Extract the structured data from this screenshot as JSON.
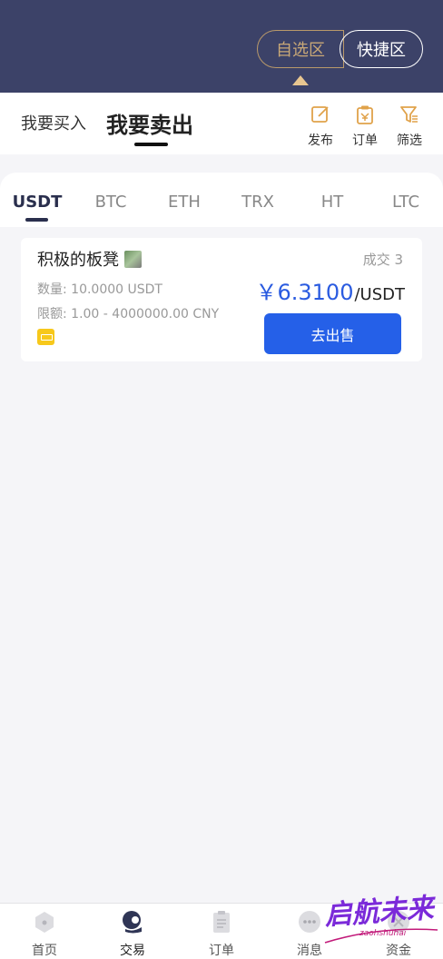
{
  "header": {
    "segment_left": "自选区",
    "segment_right": "快捷区"
  },
  "mode": {
    "buy_label": "我要买入",
    "sell_label": "我要卖出",
    "tools": [
      {
        "label": "发布",
        "icon": "edit-icon"
      },
      {
        "label": "订单",
        "icon": "clipboard-icon"
      },
      {
        "label": "筛选",
        "icon": "filter-icon"
      }
    ]
  },
  "coins": [
    "USDT",
    "BTC",
    "ETH",
    "TRX",
    "HT",
    "LTC"
  ],
  "active_coin": "USDT",
  "listing": {
    "merchant": "积极的板凳",
    "deals": "成交 3",
    "quantity": "数量:  10.0000 USDT",
    "limit": "限额:  1.00 - 4000000.00 CNY",
    "price_symbol": "￥",
    "price": "6.3100",
    "price_unit": "/USDT",
    "action": "去出售"
  },
  "tabbar": {
    "items": [
      {
        "label": "首页",
        "icon": "home-icon"
      },
      {
        "label": "交易",
        "icon": "trade-icon"
      },
      {
        "label": "订单",
        "icon": "order-icon"
      },
      {
        "label": "消息",
        "icon": "message-icon"
      },
      {
        "label": "资金",
        "icon": "wallet-icon"
      }
    ],
    "active": "交易"
  },
  "watermark": {
    "text": "启航未来",
    "sub": "zaohshuhai"
  },
  "colors": {
    "header_bg": "#3c4268",
    "accent_gold": "#c9a877",
    "price_blue": "#2a5be0",
    "button_blue": "#2560e8"
  }
}
